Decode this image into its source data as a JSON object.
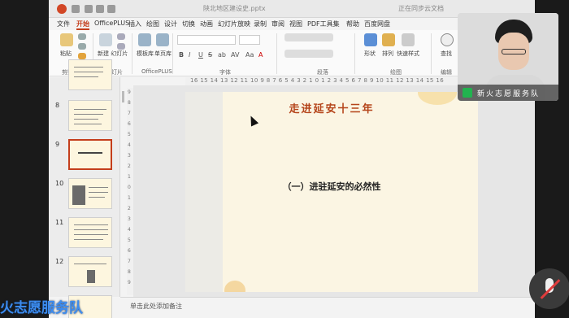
{
  "titlebar": {
    "title": "陕北地区建设史.pptx",
    "right_text": "正在同步云文档"
  },
  "menu": {
    "items": [
      "文件",
      "开始",
      "OfficePLUS",
      "插入",
      "绘图",
      "设计",
      "切换",
      "动画",
      "幻灯片放映",
      "录制",
      "审阅",
      "视图",
      "PDF工具集",
      "帮助",
      "百度网盘"
    ],
    "active_index": 1
  },
  "ribbon": {
    "paste_label": "粘贴",
    "new_slide_label": "新建\n幻灯片",
    "template_label": "模板库",
    "single_label": "单页库",
    "shape_label": "形状",
    "arrange_label": "排列",
    "quick_style_label": "快速样式",
    "find_label": "查找",
    "groups": [
      "剪贴板",
      "幻灯片",
      "OfficePLUS",
      "字体",
      "段落",
      "绘图",
      "编辑"
    ],
    "format_buttons": [
      "B",
      "I",
      "U",
      "S",
      "ab",
      "AV",
      "Aa",
      "A"
    ]
  },
  "thumbnails": {
    "slides": [
      {
        "number": "8",
        "selected": false
      },
      {
        "number": "9",
        "selected": true
      },
      {
        "number": "10",
        "selected": false
      },
      {
        "number": "11",
        "selected": false
      },
      {
        "number": "12",
        "selected": false
      }
    ]
  },
  "ruler": {
    "horizontal": "16 15 14 13 12 11 10 9 8 7 6 5 4 3 2 1 0 1 2 3 4 5 6 7 8 9 10 11 12 13 14 15 16",
    "vertical": [
      "9",
      "8",
      "7",
      "6",
      "5",
      "4",
      "3",
      "2",
      "1",
      "0",
      "1",
      "2",
      "3",
      "4",
      "5",
      "6",
      "7",
      "8",
      "9"
    ]
  },
  "slide": {
    "title": "走进延安十三年",
    "subtitle": "（一）进驻延安的必然性"
  },
  "notes": {
    "placeholder": "单击此处添加备注"
  },
  "webcam": {
    "name": "新火志愿服务队"
  },
  "overlay": {
    "text": "火志愿服务队"
  },
  "colors": {
    "accent": "#c43e1c",
    "slide_title": "#b5451b",
    "slide_bg": "#fbf5e3",
    "overlay_text": "#3c8cf0"
  }
}
